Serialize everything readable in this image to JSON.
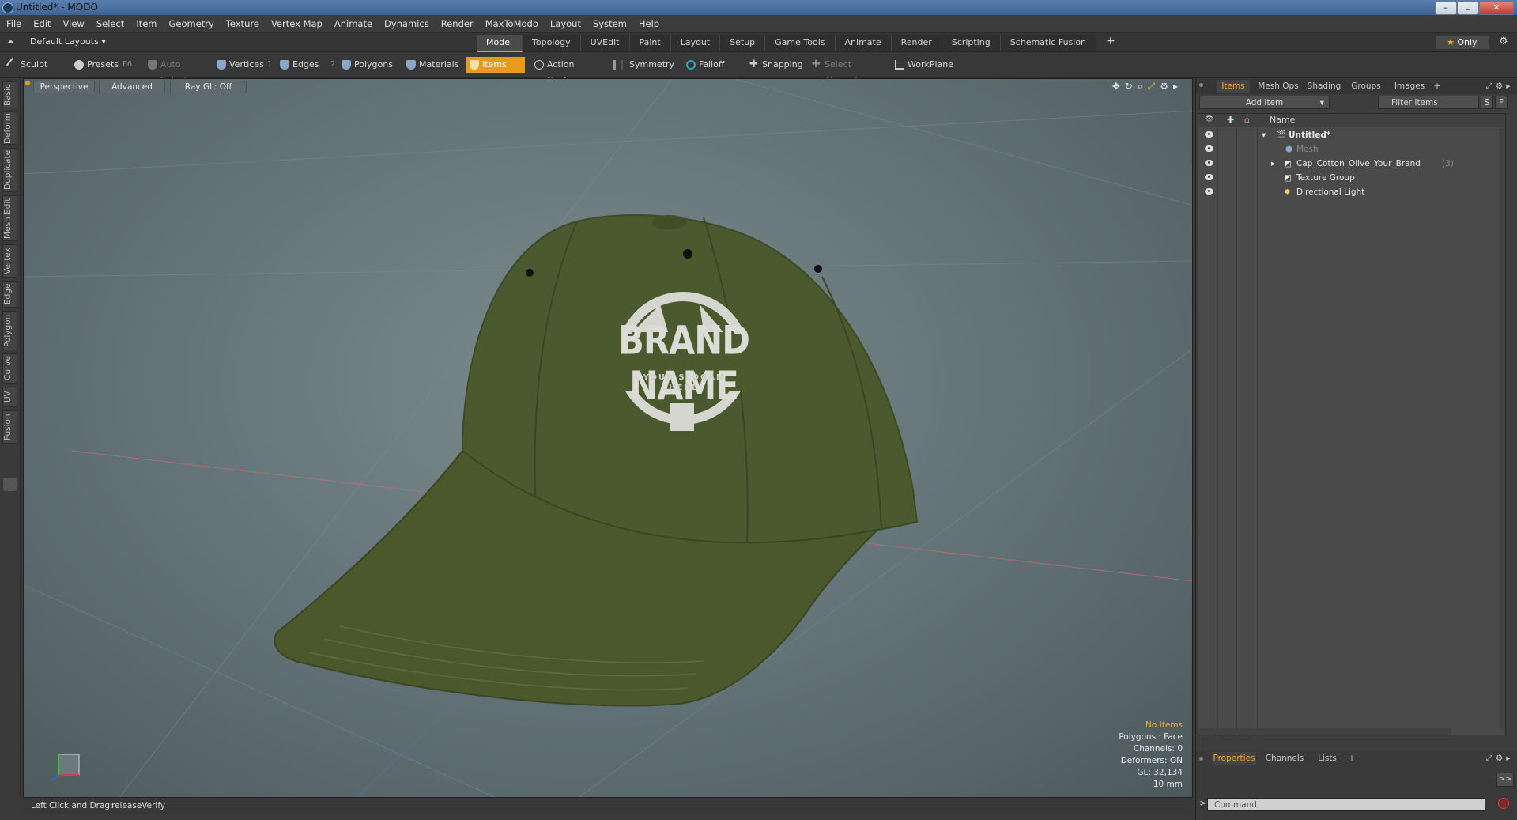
{
  "window": {
    "title": "Untitled* - MODO"
  },
  "menu": [
    "File",
    "Edit",
    "View",
    "Select",
    "Item",
    "Geometry",
    "Texture",
    "Vertex Map",
    "Animate",
    "Dynamics",
    "Render",
    "MaxToModo",
    "Layout",
    "System",
    "Help"
  ],
  "layout": {
    "selector": "Default Layouts",
    "tabs": [
      "Model",
      "Topology",
      "UVEdit",
      "Paint",
      "Layout",
      "Setup",
      "Game Tools",
      "Animate",
      "Render",
      "Scripting",
      "Schematic Fusion"
    ],
    "active_tab": "Model",
    "only_label": "Only"
  },
  "toolbar": {
    "sculpt": "Sculpt",
    "presets": "Presets",
    "presets_key": "F6",
    "auto_select": "Auto Select",
    "vertices": "Vertices",
    "vertices_key": "1",
    "edges": "Edges",
    "edges_key": "2",
    "polygons": "Polygons",
    "materials": "Materials",
    "items": "Items",
    "action_center": "Action Center",
    "symmetry": "Symmetry",
    "falloff": "Falloff",
    "snapping": "Snapping",
    "select_through": "Select Through",
    "workplane": "WorkPlane"
  },
  "left_tabs": [
    "Basic",
    "Deform",
    "Duplicate",
    "Mesh Edit",
    "Vertex",
    "Edge",
    "Polygon",
    "Curve",
    "UV",
    "Fusion"
  ],
  "viewport": {
    "view": "Perspective",
    "advanced": "Advanced",
    "raygl": "Ray GL: Off",
    "cap_brand": "BRAND NAME",
    "cap_slogan1": "YOUR SLOGAN",
    "cap_slogan2": "HERE",
    "info": {
      "selection": "No Items",
      "polygons": "Polygons : Face",
      "channels": "Channels: 0",
      "deformers": "Deformers: ON",
      "gl": "GL: 32,134",
      "scale": "10 mm"
    }
  },
  "status": {
    "hint": "Left Click and Drag:",
    "action": "releaseVerify"
  },
  "panel": {
    "tabs": [
      "Items",
      "Mesh Ops",
      "Shading",
      "Groups",
      "Images"
    ],
    "active_tab": "Items",
    "add_item": "Add Item",
    "filter_items": "Filter Items",
    "filter_s": "S",
    "filter_f": "F",
    "column_name": "Name",
    "items": [
      {
        "label": "Untitled*",
        "count": ""
      },
      {
        "label": "Mesh",
        "count": ""
      },
      {
        "label": "Cap_Cotton_Olive_Your_Brand",
        "count": "(3)"
      },
      {
        "label": "Texture Group",
        "count": ""
      },
      {
        "label": "Directional Light",
        "count": ""
      }
    ],
    "bottom_tabs": [
      "Properties",
      "Channels",
      "Lists"
    ],
    "bottom_active": "Properties",
    "command_placeholder": "Command"
  },
  "colors": {
    "accent": "#e89a1c",
    "cap": "#4b5a2e"
  }
}
